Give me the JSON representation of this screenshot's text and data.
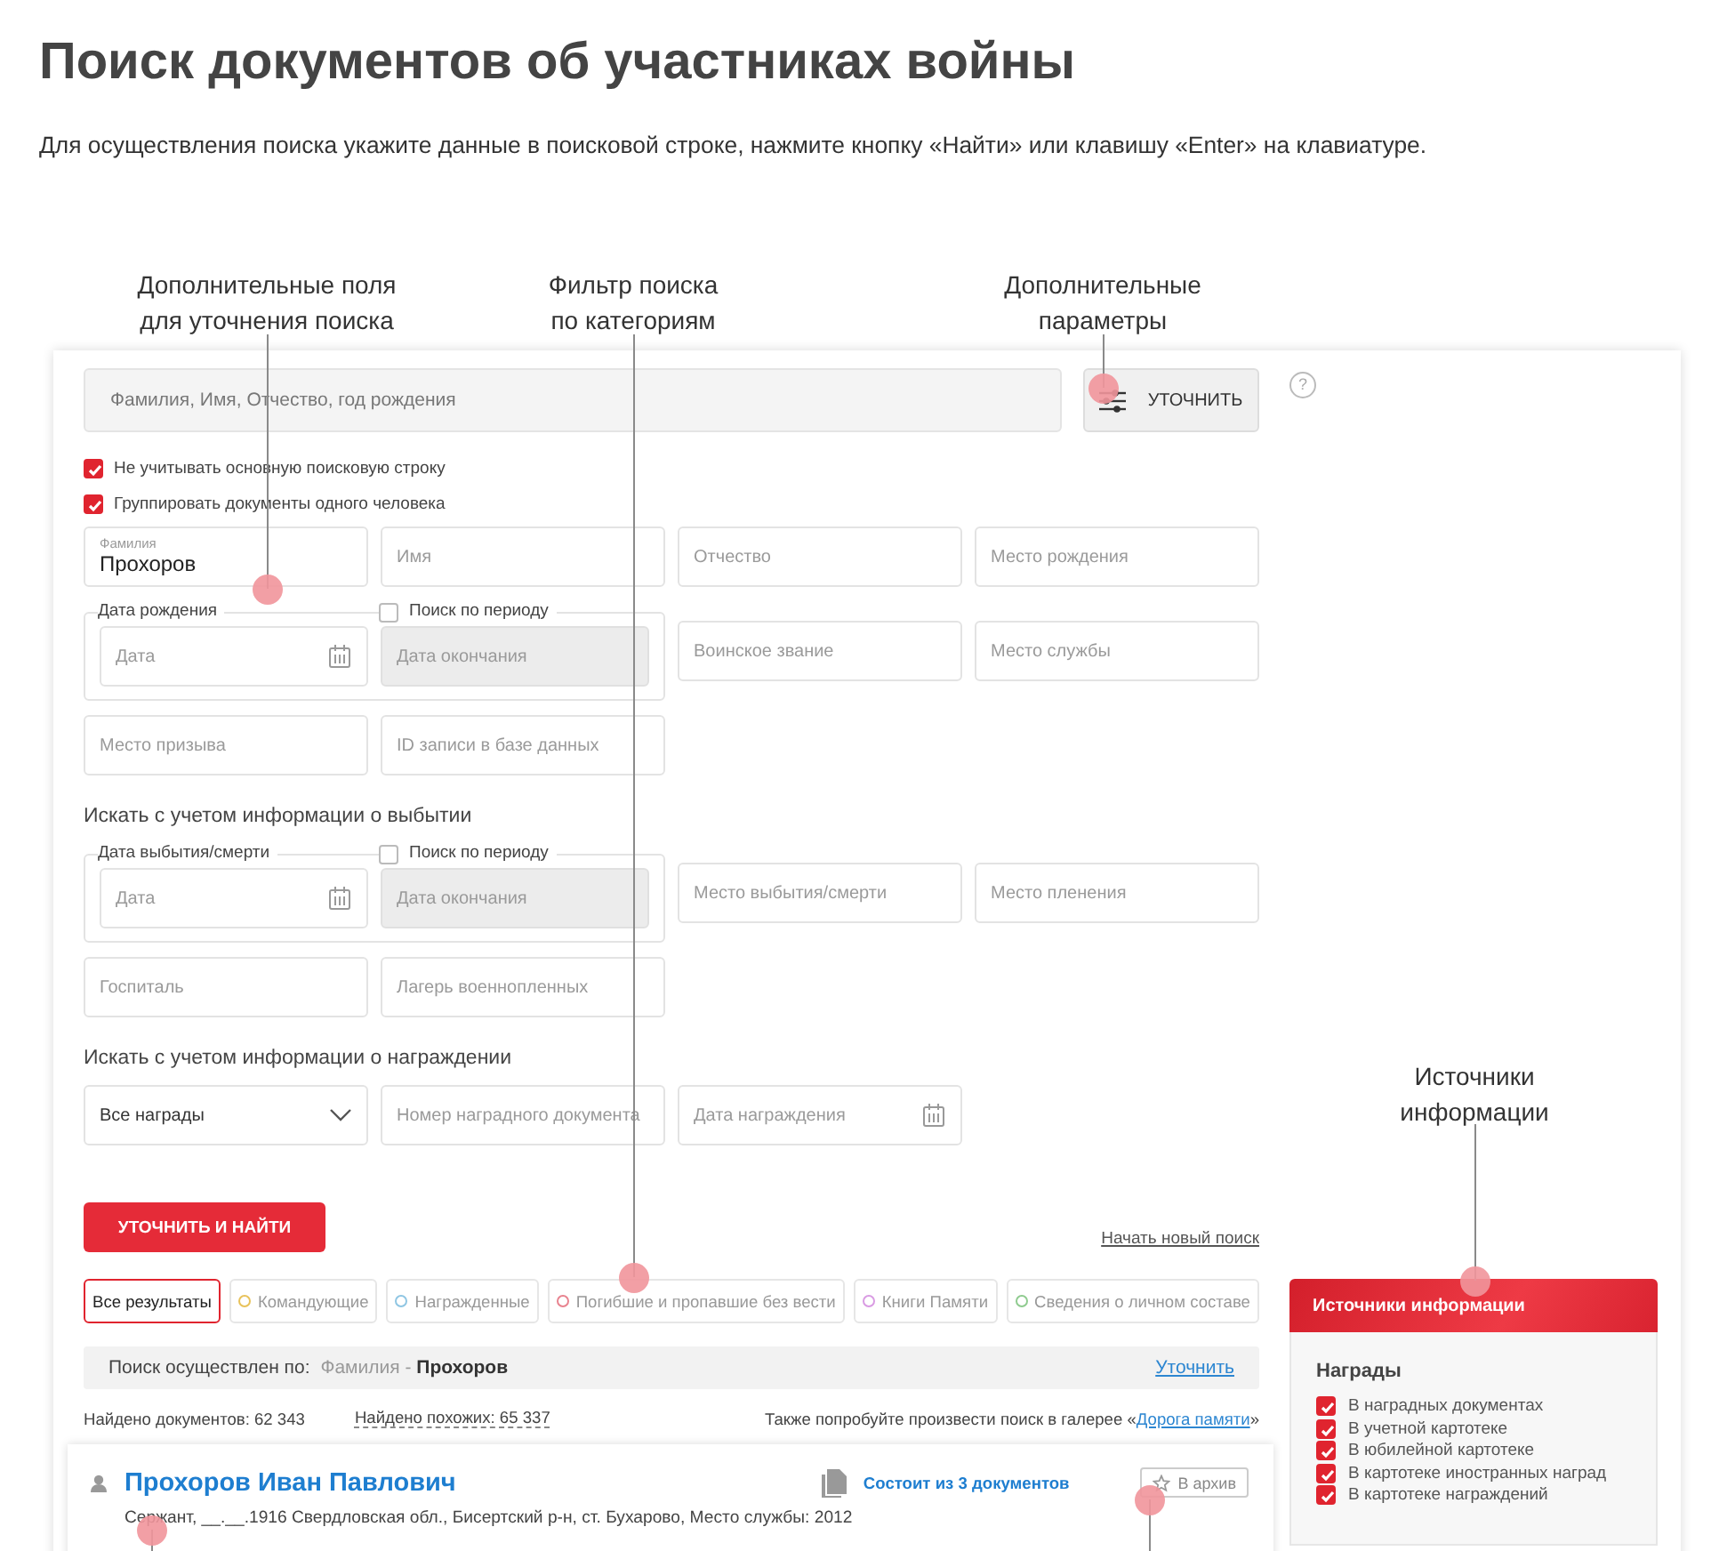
{
  "page": {
    "title": "Поиск документов об участниках войны",
    "intro": "Для осуществления поиска укажите данные в поисковой строке, нажмите кнопку «Найти» или клавишу «Enter» на клавиатуре."
  },
  "callouts": [
    {
      "lines": [
        "Дополнительные поля",
        "для уточнения поиска"
      ]
    },
    {
      "lines": [
        "Фильтр поиска",
        "по категориям"
      ]
    },
    {
      "lines": [
        "Дополнительные",
        "параметры"
      ]
    },
    {
      "lines": [
        "Источники",
        "информации"
      ]
    }
  ],
  "search": {
    "placeholder": "Фамилия, Имя, Отчество, год рождения",
    "button": "УТОЧНИТЬ",
    "help": "?"
  },
  "options": [
    {
      "label": "Не учитывать основную поисковую строку",
      "checked": true
    },
    {
      "label": "Группировать документы одного человека",
      "checked": true
    }
  ],
  "form_sections": [
    {
      "items": [
        {
          "kind": "field",
          "label": "Фамилия",
          "value": "Прохоров"
        },
        {
          "kind": "field",
          "placeholder": "Имя"
        },
        {
          "kind": "field",
          "placeholder": "Отчество"
        },
        {
          "kind": "field",
          "placeholder": "Место рождения"
        },
        {
          "kind": "period",
          "legend": "Дата рождения",
          "period_label": "Поиск по периоду",
          "period_checked": false,
          "from_placeholder": "Дата",
          "to_placeholder": "Дата окончания",
          "to_disabled": true
        },
        {
          "kind": "field",
          "placeholder": "Воинское звание"
        },
        {
          "kind": "field",
          "placeholder": "Место службы"
        },
        {
          "kind": "field",
          "placeholder": "Место призыва"
        },
        {
          "kind": "field",
          "placeholder": "ID записи в базе данных"
        }
      ]
    },
    {
      "heading": "Искать с учетом информации о выбытии",
      "items": [
        {
          "kind": "period",
          "legend": "Дата выбытия/смерти",
          "period_label": "Поиск по периоду",
          "period_checked": false,
          "from_placeholder": "Дата",
          "to_placeholder": "Дата окончания",
          "to_disabled": true
        },
        {
          "kind": "field",
          "placeholder": "Место выбытия/смерти"
        },
        {
          "kind": "field",
          "placeholder": "Место пленения"
        },
        {
          "kind": "field",
          "placeholder": "Госпиталь"
        },
        {
          "kind": "field",
          "placeholder": "Лагерь военнопленных"
        }
      ]
    },
    {
      "heading": "Искать с учетом информации о награждении",
      "items": [
        {
          "kind": "select",
          "value": "Все награды"
        },
        {
          "kind": "field",
          "placeholder": "Номер наградного документа"
        },
        {
          "kind": "date",
          "placeholder": "Дата награждения"
        }
      ]
    }
  ],
  "actions": {
    "submit": "УТОЧНИТЬ И НАЙТИ",
    "reset_link": "Начать новый поиск"
  },
  "categories": [
    {
      "label": "Все результаты",
      "selected": true
    },
    {
      "label": "Командующие",
      "selected": false,
      "color": "#e8c25a"
    },
    {
      "label": "Награжденные",
      "selected": false,
      "color": "#8fc6e3"
    },
    {
      "label": "Погибшие и пропавшие без вести",
      "selected": false,
      "color": "#e8838f"
    },
    {
      "label": "Книги Памяти",
      "selected": false,
      "color": "#d99be3"
    },
    {
      "label": "Сведения о личном составе",
      "selected": false,
      "color": "#8fcb8f"
    }
  ],
  "query_bar": {
    "prefix": "Поиск осуществлен по:",
    "criterion": "Фамилия - **Прохоров**",
    "link": "Уточнить"
  },
  "stats": {
    "found": "Найдено документов: 62 343",
    "similar": "Найдено похожих: 65 337",
    "gallery_before": "Также попробуйте произвести поиск в галерее «",
    "gallery_link": "Дорога памяти",
    "gallery_after": "»"
  },
  "result": {
    "name": "Прохоров Иван Павлович",
    "details": "Сержант, __.__.1916 Свердловская обл., Бисертский р-н, ст. Бухарово, Место службы: 2012",
    "documents": "Состоит из 3 документов",
    "archive": "В архив"
  },
  "sources": {
    "title": "Источники информации",
    "group": "Награды",
    "items": [
      {
        "label": "В наградных документах",
        "checked": true
      },
      {
        "label": "В учетной картотеке",
        "checked": true
      },
      {
        "label": "В юбилейной картотеке",
        "checked": true
      },
      {
        "label": "В картотеке иностранных наград",
        "checked": true
      },
      {
        "label": "В картотеке награждений",
        "checked": true
      }
    ]
  }
}
